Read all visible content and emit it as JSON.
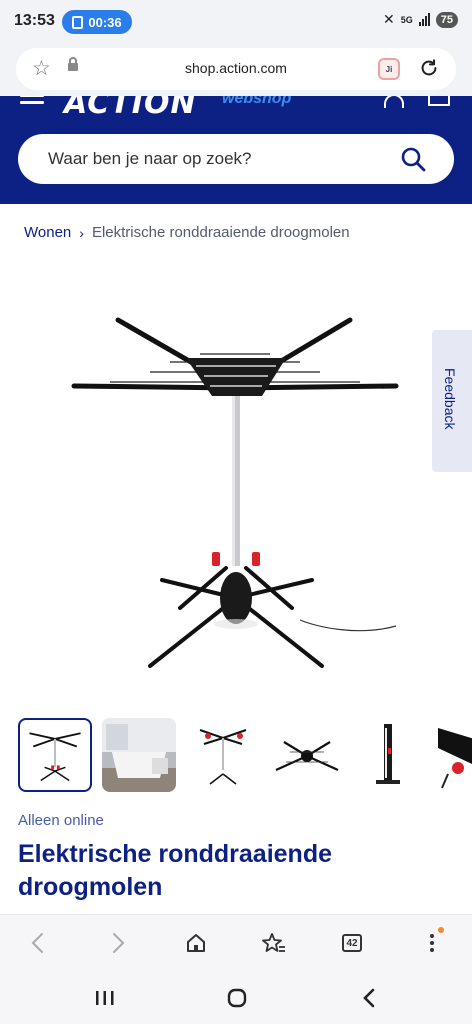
{
  "status_bar": {
    "time": "13:53",
    "timer": "00:36",
    "network": "5G",
    "battery": "75"
  },
  "browser": {
    "url": "shop.action.com",
    "extension_label": "Ji",
    "tab_count": "42"
  },
  "header": {
    "logo": "ACTION",
    "logo_sub": "webshop",
    "search_placeholder": "Waar ben je naar op zoek?",
    "brand_color": "#0d2185"
  },
  "breadcrumb": {
    "home": "Wonen",
    "separator": "›",
    "current": "Elektrische ronddraaiende droogmolen"
  },
  "feedback": {
    "label": "Feedback"
  },
  "product": {
    "availability": "Alleen online",
    "title": "Elektrische ronddraaiende droogmolen",
    "thumbnails": [
      "droogmolen-front",
      "droogmolen-room",
      "droogmolen-angle",
      "droogmolen-top",
      "droogmolen-folded",
      "droogmolen-detail"
    ]
  },
  "icons": {
    "toolbar": [
      "back-icon",
      "forward-icon",
      "home-icon",
      "bookmark-star-icon",
      "tabs-icon",
      "more-icon"
    ],
    "nav": [
      "recents-icon",
      "home-circle-icon",
      "back-chevron-icon"
    ]
  }
}
